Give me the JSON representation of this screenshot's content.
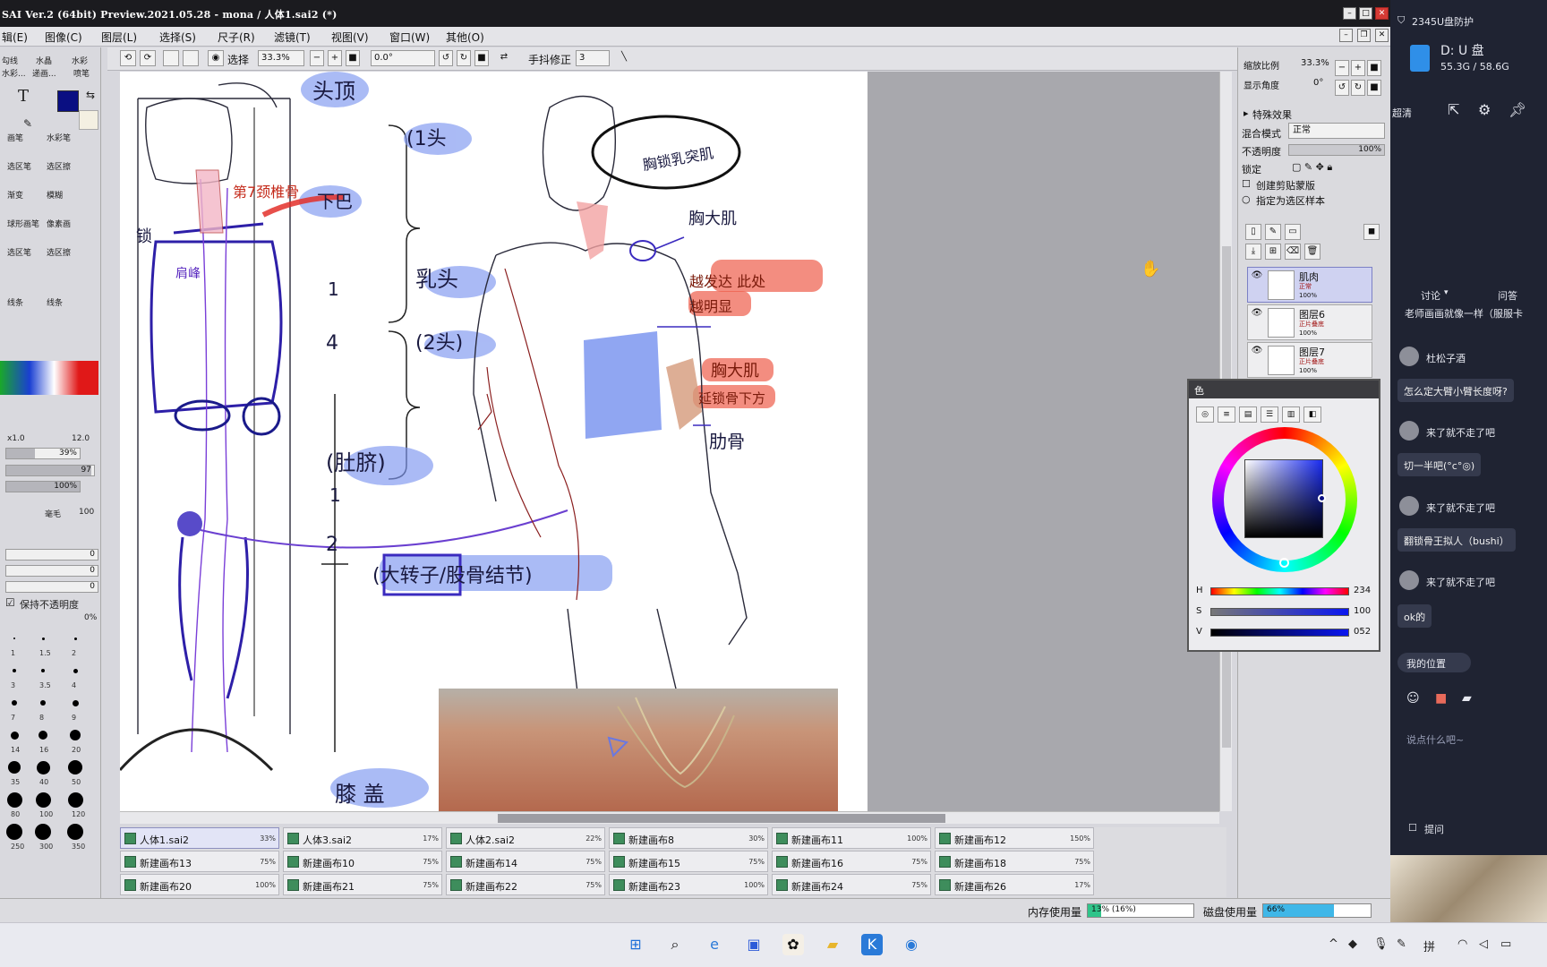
{
  "sai": {
    "title": "SAI Ver.2 (64bit) Preview.2021.05.28 - mona / 人体1.sai2 (*)",
    "menu": [
      "辑(E)",
      "图像(C)",
      "图层(L)",
      "选择(S)",
      "尺子(R)",
      "滤镜(T)",
      "视图(V)",
      "窗口(W)",
      "其他(O)"
    ],
    "toolbar": {
      "select_label": "选择",
      "zoom": "33.3%",
      "angle": "0.0°",
      "stabilizer_label": "手抖修正",
      "stabilizer_value": "3"
    },
    "left_panel": {
      "tool_tabs": [
        "勾线",
        "水晶",
        "水彩"
      ],
      "tool_tabs2": [
        "水彩...",
        "递画...",
        "喷笔"
      ],
      "brush_names": [
        "画笔",
        "水彩笔",
        "选区笔",
        "选区擦",
        "渐变",
        "模糊",
        "球形画笔",
        "像素画",
        "选区笔",
        "选区擦",
        "线条",
        "线条"
      ],
      "brush_size_min": "x1.0",
      "brush_size_max": "12.0",
      "density": "39%",
      "hardness": "97",
      "opacity": "100%",
      "texture_label": "毫毛",
      "texture_value": "100",
      "field_values": [
        "0",
        "0",
        "0"
      ],
      "keep_opacity_label": "保持不透明度",
      "keep_opacity_value": "0%",
      "brush_sizes": [
        "1",
        "1.5",
        "2",
        "3",
        "3.5",
        "4",
        "7",
        "8",
        "9",
        "14",
        "16",
        "20",
        "35",
        "40",
        "50",
        "80",
        "100",
        "120",
        "250",
        "300",
        "350"
      ]
    },
    "right_panel": {
      "zoom_label": "缩放比例",
      "zoom_value": "33.3%",
      "angle_label": "显示角度",
      "angle_value": "0°",
      "effects_label": "特殊效果",
      "blend_label": "混合模式",
      "blend_value": "正常",
      "opacity_label": "不透明度",
      "opacity_value": "100%",
      "lock_label": "锁定",
      "clip_label": "创建剪贴蒙版",
      "sample_label": "指定为选区样本",
      "layers": [
        {
          "name": "肌肉",
          "mode": "正常",
          "opacity": "100%"
        },
        {
          "name": "图层6",
          "mode": "正片叠底",
          "opacity": "100%"
        },
        {
          "name": "图层7",
          "mode": "正片叠底",
          "opacity": "100%"
        }
      ]
    },
    "file_tabs": [
      {
        "name": "人体1.sai2",
        "zoom": "33%"
      },
      {
        "name": "人体3.sai2",
        "zoom": "17%"
      },
      {
        "name": "人体2.sai2",
        "zoom": "22%"
      },
      {
        "name": "新建画布8",
        "zoom": "30%"
      },
      {
        "name": "新建画布11",
        "zoom": "100%"
      },
      {
        "name": "新建画布12",
        "zoom": "150%"
      },
      {
        "name": "新建画布13",
        "zoom": "75%"
      },
      {
        "name": "新建画布10",
        "zoom": "75%"
      },
      {
        "name": "新建画布14",
        "zoom": "75%"
      },
      {
        "name": "新建画布15",
        "zoom": "75%"
      },
      {
        "name": "新建画布16",
        "zoom": "75%"
      },
      {
        "name": "新建画布18",
        "zoom": "75%"
      },
      {
        "name": "新建画布20",
        "zoom": "100%"
      },
      {
        "name": "新建画布21",
        "zoom": "75%"
      },
      {
        "name": "新建画布22",
        "zoom": "75%"
      },
      {
        "name": "新建画布23",
        "zoom": "100%"
      },
      {
        "name": "新建画布24",
        "zoom": "75%"
      },
      {
        "name": "新建画布26",
        "zoom": "17%"
      }
    ],
    "status": {
      "memory_label": "内存使用量",
      "memory_value": "13% (16%)",
      "memory_fraction": 0.13,
      "disk_label": "磁盘使用量",
      "disk_value": "66%",
      "disk_fraction": 0.66
    },
    "color_panel": {
      "title": "色",
      "h_label": "H",
      "h_value": "234",
      "h_fraction": 0.65,
      "s_label": "S",
      "s_value": "100",
      "s_fraction": 1.0,
      "v_label": "V",
      "v_value": "052",
      "v_fraction": 0.52,
      "current_color": "#0a0f82"
    }
  },
  "drawing": {
    "labels": [
      "头顶",
      "(1头",
      "下巴",
      "第7颈椎骨",
      "锁",
      "肩峰",
      "乳头",
      "(2头)",
      "1",
      "4",
      "(肚脐)",
      "1",
      "2",
      "(大转子/股骨结节)",
      "胸锁乳突肌",
      "胸大肌",
      "越发达 此处",
      "越明显",
      "胸大肌",
      "延锁骨下方",
      "肋骨",
      "膝 盖"
    ]
  },
  "chat": {
    "usb_title": "2345U盘防护",
    "drive_name": "D: U 盘",
    "drive_usage": "55.3G / 58.6G",
    "clear_label": "超清",
    "tab_discuss": "讨论",
    "tab_qa": "问答",
    "partial_msg": "老师画画就像一样（服服卡",
    "messages": [
      {
        "user": "杜松子酒",
        "text": "怎么定大臂小臂长度呀?"
      },
      {
        "user": "来了就不走了吧",
        "text": "切一半吧(°c°◎)"
      },
      {
        "user": "来了就不走了吧",
        "text": "翻锁骨王拟人（bushi）"
      },
      {
        "user": "来了就不走了吧",
        "text": "ok的"
      }
    ],
    "location_label": "我的位置",
    "input_placeholder": "说点什么吧~",
    "ask_label": "提问"
  },
  "colors": {
    "accent_blue": "#0a0f82",
    "highlight_blue": "#7d96f0",
    "highlight_red": "#ee5c4a",
    "ink_purple": "#3b2bbf"
  }
}
